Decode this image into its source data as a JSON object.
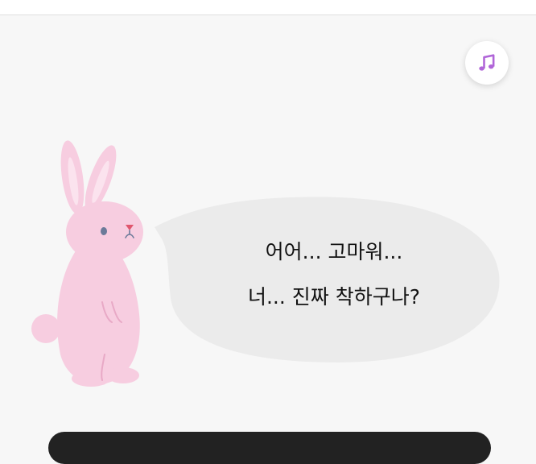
{
  "dialogue": {
    "line1": "어어... 고마워...",
    "line2": "너... 진짜 착하구나?"
  },
  "music_button": {
    "icon": "music-note-icon"
  },
  "colors": {
    "background": "#f7f7f7",
    "bubble": "#ebebeb",
    "rabbit_body": "#f7cde0",
    "rabbit_ear_inner": "#fbe3ee",
    "rabbit_nose": "#e0566e",
    "rabbit_eye": "#6b7a99",
    "music_icon": "#b065d8"
  }
}
